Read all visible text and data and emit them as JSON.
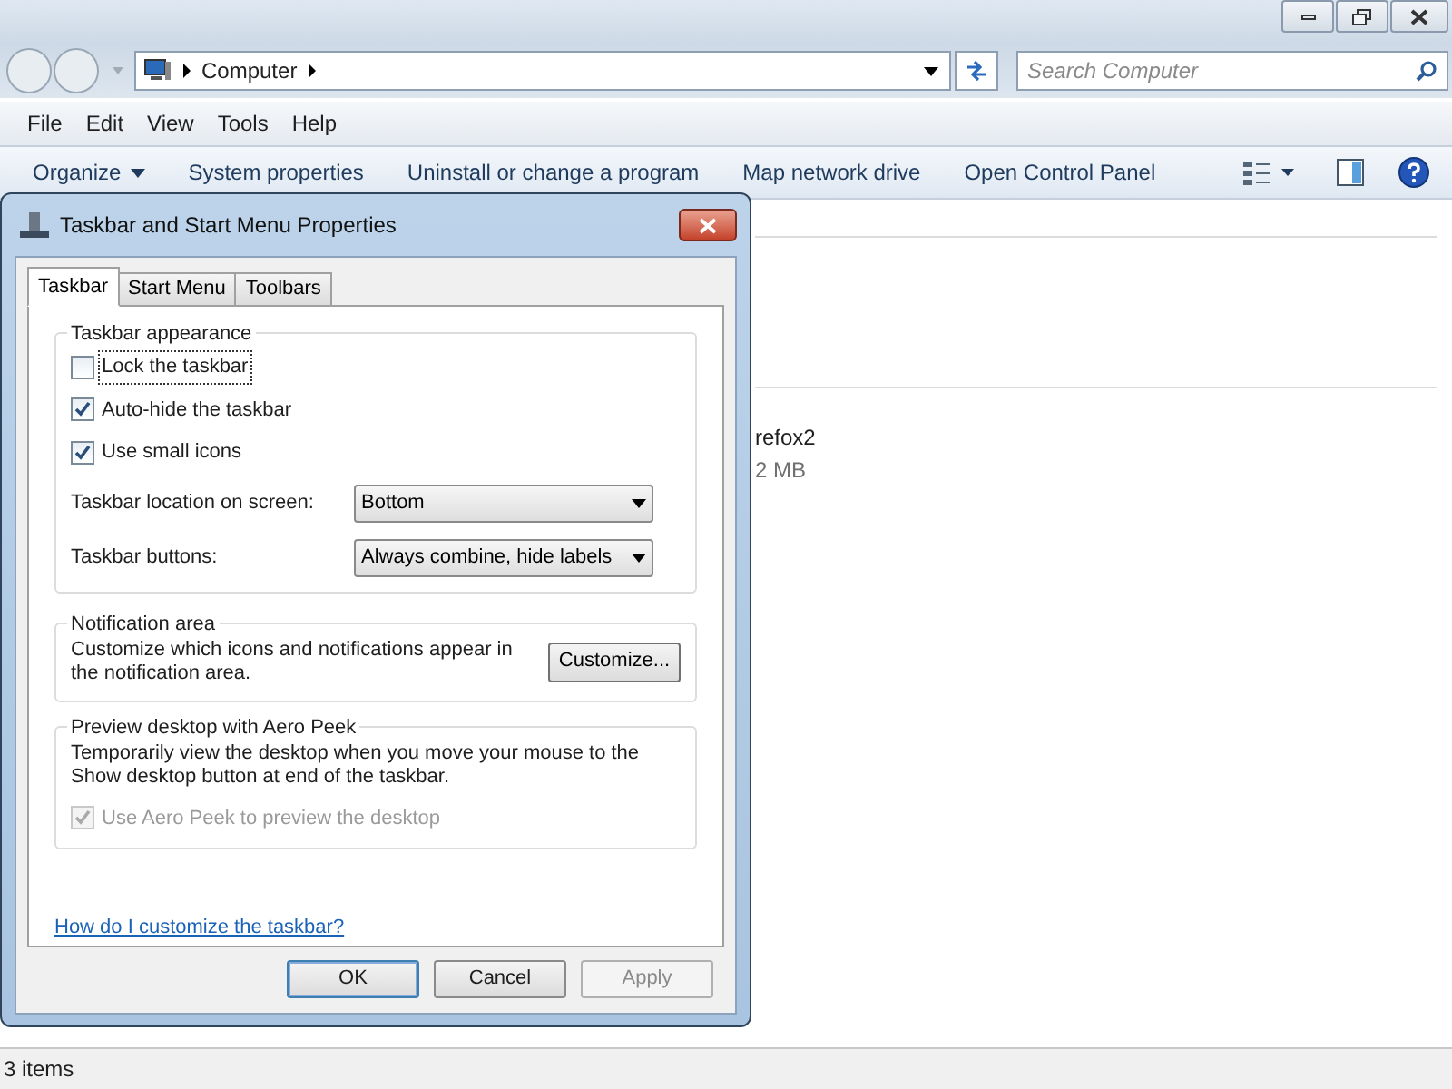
{
  "explorer": {
    "address": "Computer",
    "search": {
      "placeholder": "Search Computer"
    },
    "menu": [
      "File",
      "Edit",
      "View",
      "Tools",
      "Help"
    ],
    "commands": [
      {
        "label": "Organize",
        "dropdown": true
      },
      {
        "label": "System properties",
        "dropdown": false
      },
      {
        "label": "Uninstall or change a program",
        "dropdown": false
      },
      {
        "label": "Map network drive",
        "dropdown": false
      },
      {
        "label": "Open Control Panel",
        "dropdown": false
      }
    ],
    "items": [
      {
        "name": "refox2",
        "size": "2 MB"
      }
    ],
    "status_bar": "3 items"
  },
  "dialog": {
    "title": "Taskbar and Start Menu Properties",
    "tabs": [
      {
        "label": "Taskbar",
        "selected": true
      },
      {
        "label": "Start Menu",
        "selected": false
      },
      {
        "label": "Toolbars",
        "selected": false
      }
    ],
    "appearance": {
      "title": "Taskbar appearance",
      "checkboxes": [
        {
          "label": "Lock the taskbar",
          "checked": false,
          "focused": true
        },
        {
          "label": "Auto-hide the taskbar",
          "checked": true,
          "focused": false
        },
        {
          "label": "Use small icons",
          "checked": true,
          "focused": false
        }
      ],
      "selects": [
        {
          "label": "Taskbar location on screen:",
          "value": "Bottom"
        },
        {
          "label": "Taskbar buttons:",
          "value": "Always combine, hide labels"
        }
      ]
    },
    "notification": {
      "title": "Notification area",
      "text": "Customize which icons and notifications appear in the notification area.",
      "button": "Customize..."
    },
    "peek": {
      "title": "Preview desktop with Aero Peek",
      "text": "Temporarily view the desktop when you move your mouse to the Show desktop button at end of the taskbar.",
      "checkbox": {
        "label": "Use Aero Peek to preview the desktop",
        "checked": true,
        "disabled": true
      }
    },
    "help_link": "How do I customize the taskbar?",
    "buttons": [
      {
        "label": "OK",
        "default": true,
        "disabled": false
      },
      {
        "label": "Cancel",
        "default": false,
        "disabled": false
      },
      {
        "label": "Apply",
        "default": false,
        "disabled": true
      }
    ]
  }
}
